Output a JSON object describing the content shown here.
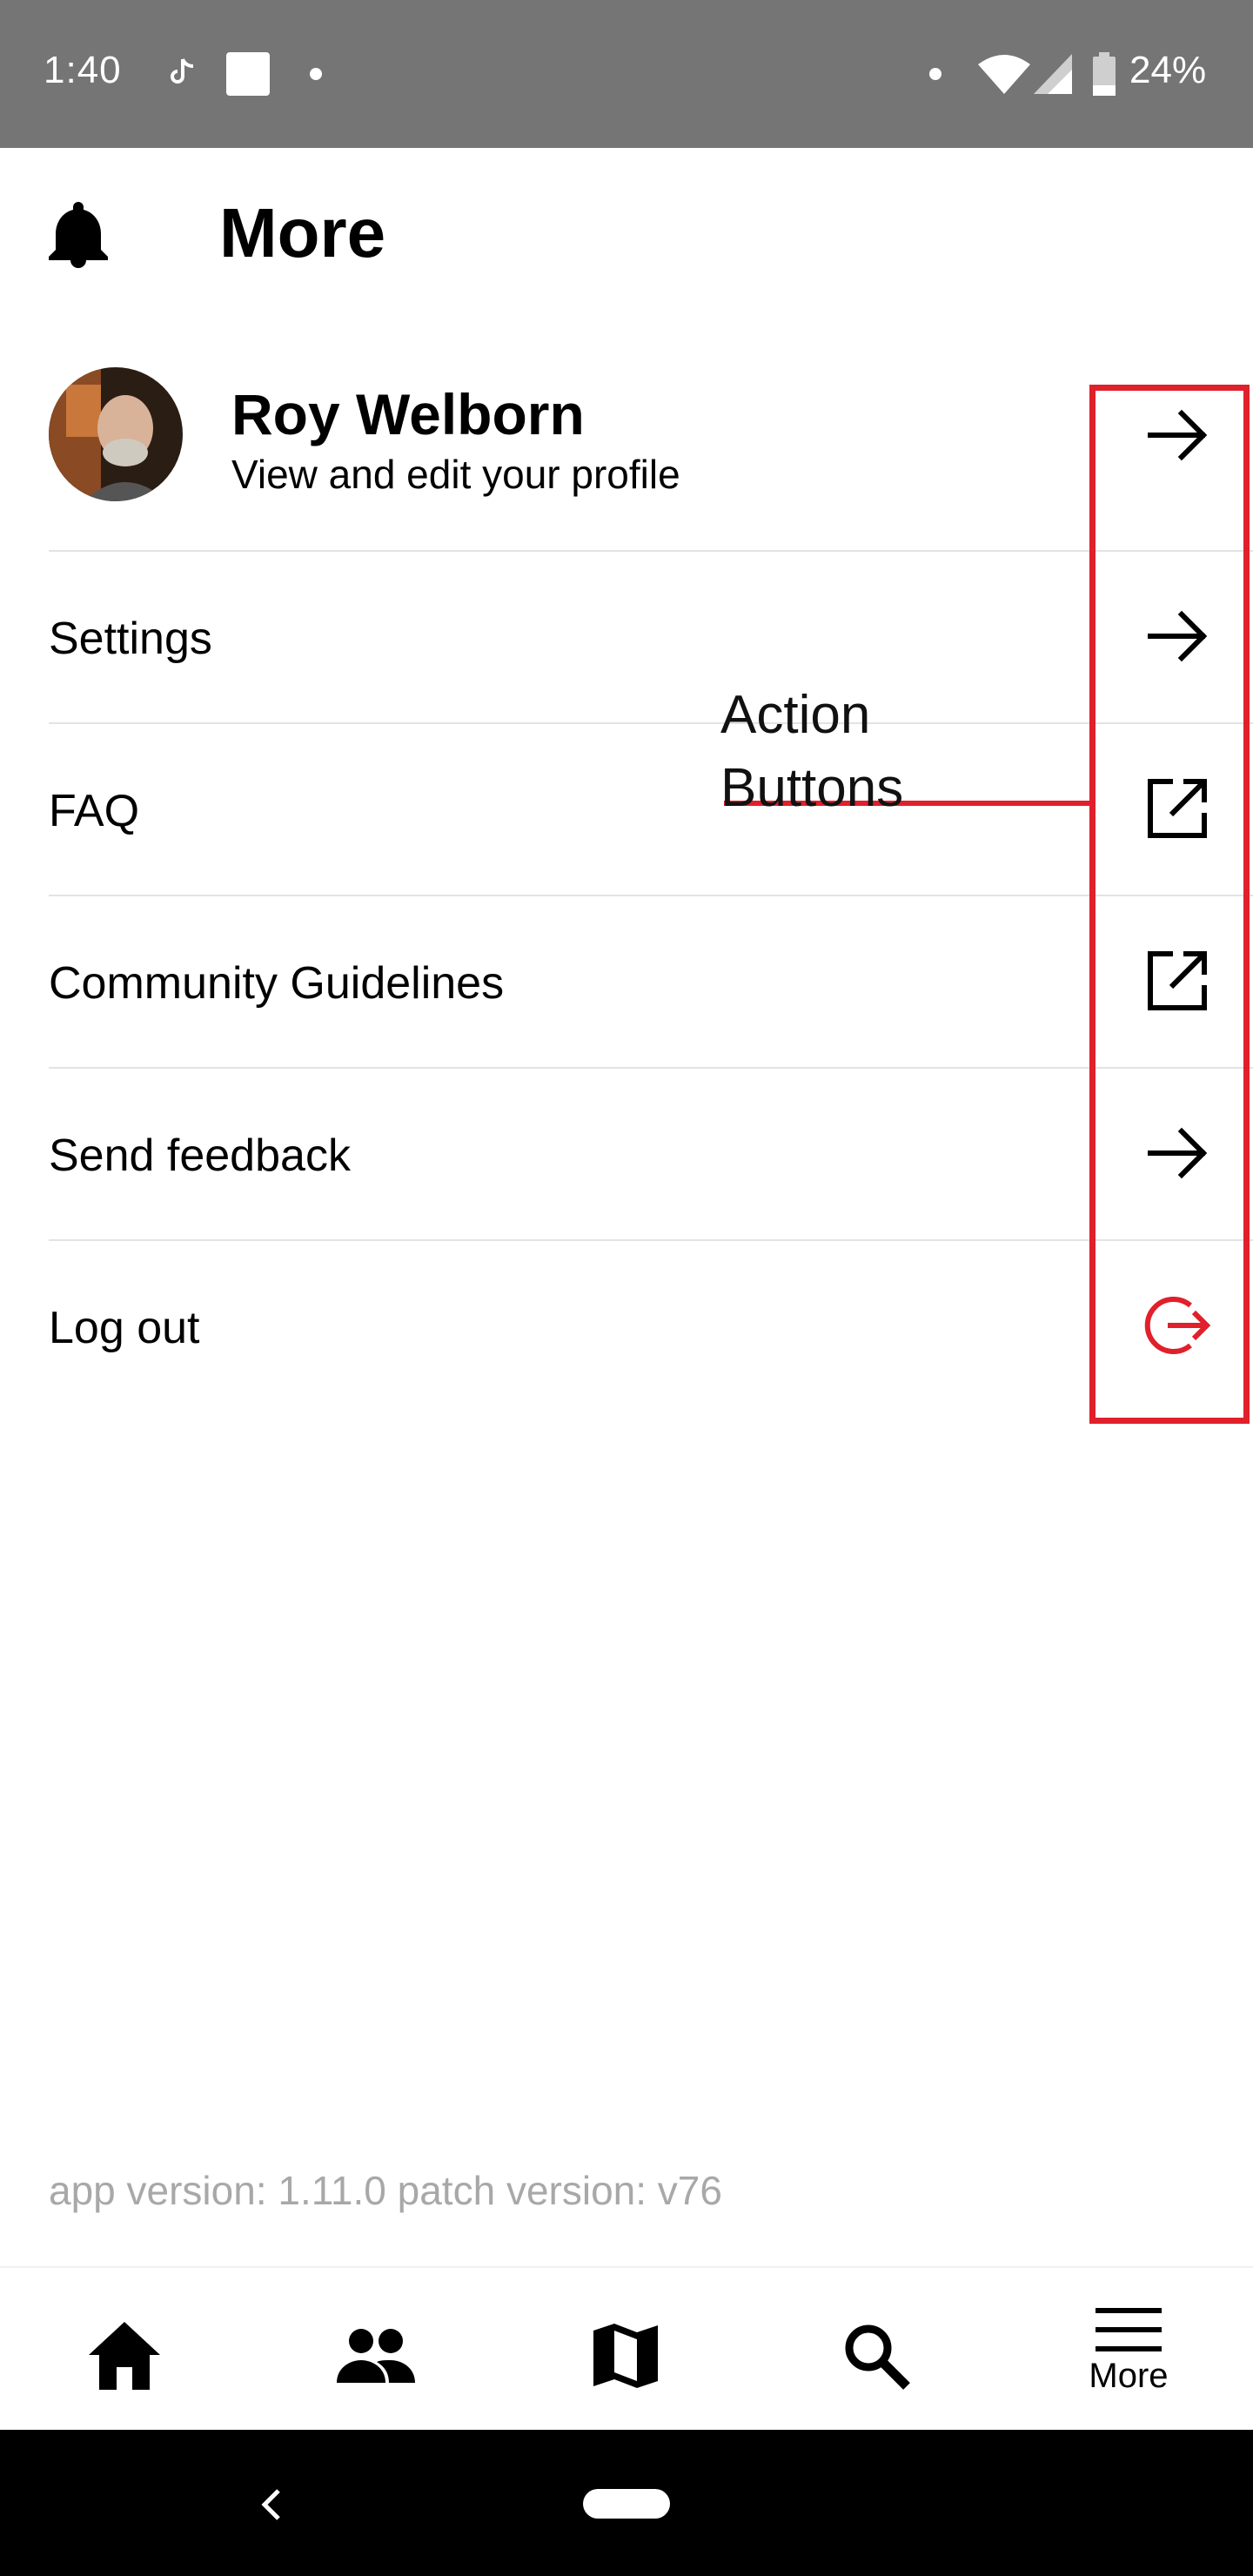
{
  "status_bar": {
    "time": "1:40",
    "battery": "24%",
    "icons": [
      "tiktok-icon",
      "mewe-app-icon",
      "notification-dot-icon",
      "wifi-icon",
      "signal-icon",
      "battery-icon"
    ]
  },
  "header": {
    "title": "More",
    "icon": "bell-icon"
  },
  "profile": {
    "name": "Roy Welborn",
    "subtitle": "View and edit your profile",
    "action_icon": "arrow-right-icon"
  },
  "menu": [
    {
      "label": "Settings",
      "action_icon": "arrow-right-icon"
    },
    {
      "label": "FAQ",
      "action_icon": "external-link-icon"
    },
    {
      "label": "Community Guidelines",
      "action_icon": "external-link-icon"
    },
    {
      "label": "Send feedback",
      "action_icon": "arrow-right-icon"
    },
    {
      "label": "Log out",
      "action_icon": "logout-icon"
    }
  ],
  "annotation": {
    "label_line1": "Action",
    "label_line2": "Buttons",
    "color": "#e0202b"
  },
  "app_version": "app version: 1.11.0 patch version: v76",
  "bottom_nav": {
    "items": [
      "home-icon",
      "people-icon",
      "map-icon",
      "search-icon",
      "menu-icon"
    ],
    "more_label": "More"
  },
  "colors": {
    "status_bar": "#757575",
    "logout_accent": "#e0202b",
    "muted_text": "#a8a8a8"
  }
}
